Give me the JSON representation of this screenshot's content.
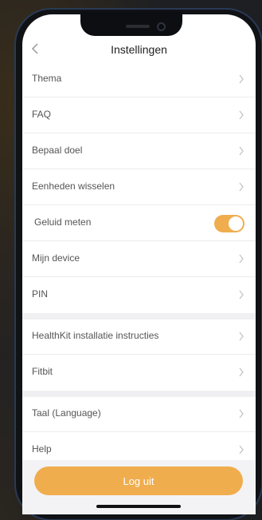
{
  "header": {
    "title": "Instellingen",
    "back_icon": "chevron-left-icon"
  },
  "settings": {
    "group1": [
      {
        "label": "Thema"
      },
      {
        "label": "FAQ"
      },
      {
        "label": "Bepaal doel"
      },
      {
        "label": "Eenheden wisselen"
      },
      {
        "label": "Geluid meten",
        "toggle": true
      },
      {
        "label": "Mijn device"
      },
      {
        "label": "PIN"
      }
    ],
    "group2": [
      {
        "label": "HealthKit installatie instructies"
      },
      {
        "label": "Fitbit"
      }
    ],
    "group3": [
      {
        "label": "Taal (Language)"
      },
      {
        "label": "Help"
      }
    ]
  },
  "logout": {
    "label": "Log uit"
  },
  "colors": {
    "accent": "#f0ad4e",
    "divider": "#ececec",
    "section_bg": "#f0f0f2"
  }
}
